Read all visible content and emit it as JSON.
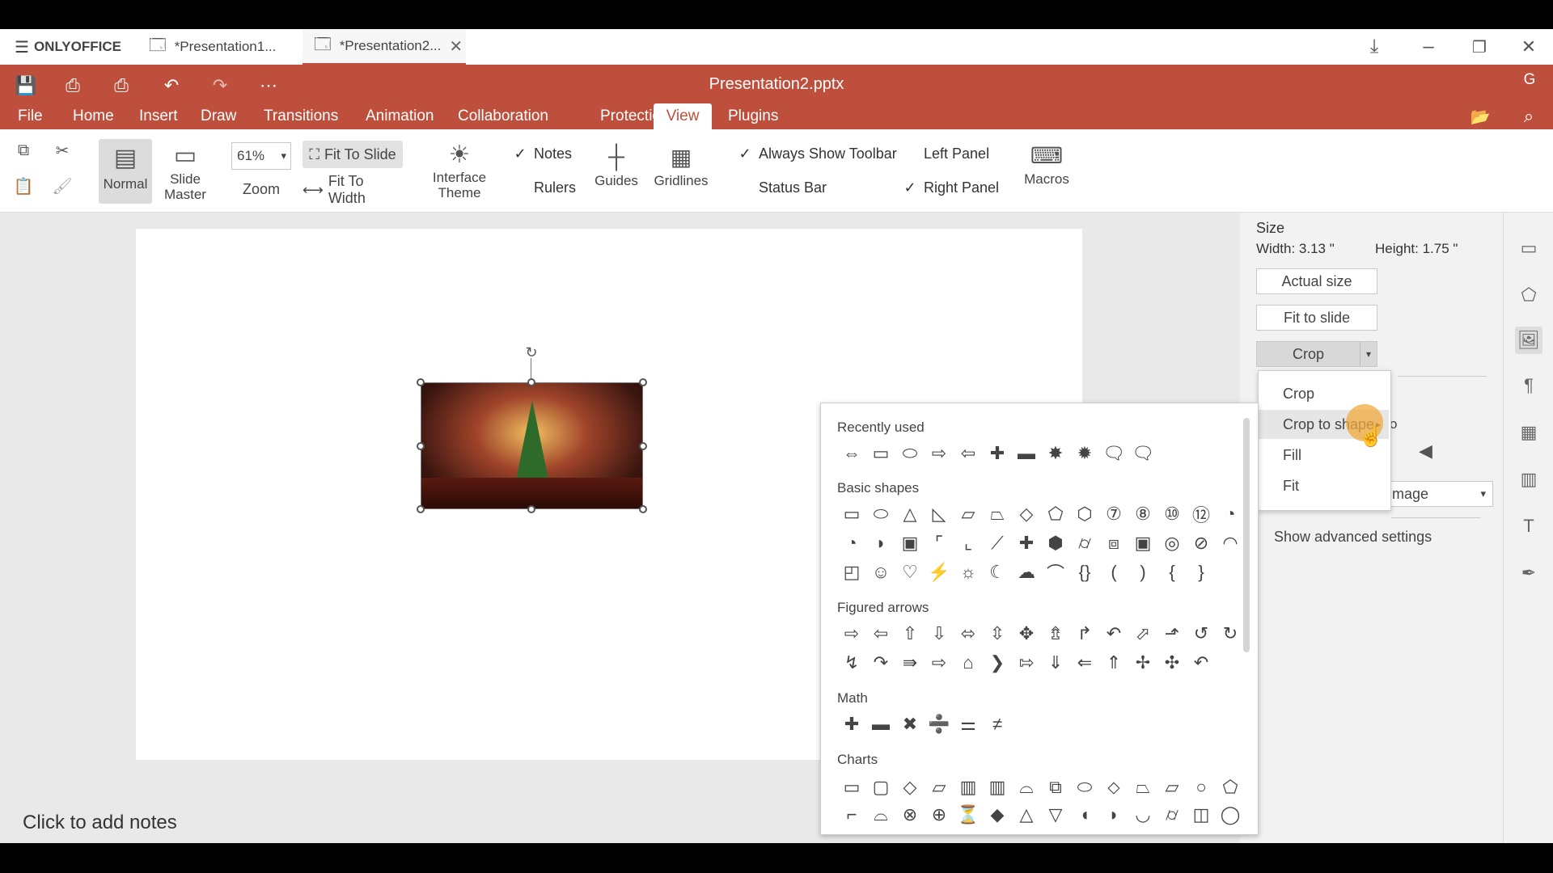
{
  "app": {
    "brand": "ONLYOFFICE",
    "file_title": "Presentation2.pptx",
    "avatar_letter": "G"
  },
  "doc_tabs": [
    {
      "label": "*Presentation1..."
    },
    {
      "label": "*Presentation2..."
    }
  ],
  "menu": [
    "File",
    "Home",
    "Insert",
    "Draw",
    "Transitions",
    "Animation",
    "Collaboration",
    "Protection",
    "View",
    "Plugins"
  ],
  "active_menu": "View",
  "ribbon": {
    "normal": "Normal",
    "slide_master": "Slide Master",
    "zoom_value": "61%",
    "zoom_label": "Zoom",
    "fit_to_slide": "Fit To Slide",
    "fit_to_width": "Fit To Width",
    "interface_theme": "Interface Theme",
    "notes": "Notes",
    "rulers": "Rulers",
    "guides": "Guides",
    "gridlines": "Gridlines",
    "always_show_toolbar": "Always Show Toolbar",
    "status_bar": "Status Bar",
    "left_panel": "Left Panel",
    "right_panel": "Right Panel",
    "macros": "Macros"
  },
  "checks": {
    "notes": true,
    "rulers": false,
    "always_show_toolbar": true,
    "status_bar": false,
    "left_panel": false,
    "right_panel": true
  },
  "right_panel": {
    "size_heading": "Size",
    "width": "Width: 3.13 \"",
    "height": "Height: 1.75 \"",
    "actual_size": "Actual size",
    "fit_to_slide": "Fit to slide",
    "crop": "Crop",
    "partial_text_1": "o",
    "image_button_partial": "mage",
    "advanced": "Show advanced settings"
  },
  "crop_menu": [
    "Crop",
    "Crop to shape",
    "Fill",
    "Fit"
  ],
  "shapes_panel": {
    "recently_used": "Recently used",
    "basic_shapes": "Basic shapes",
    "figured_arrows": "Figured arrows",
    "math": "Math",
    "charts": "Charts",
    "recent_icons": [
      "⇔",
      "▭",
      "⬭",
      "⇨",
      "⇦",
      "✚",
      "▬",
      "✸",
      "✹",
      "🗨",
      "🗨"
    ],
    "basic_row1": [
      "▭",
      "⬭",
      "△",
      "◺",
      "▱",
      "⏢",
      "◇",
      "⬠",
      "⬡",
      "⑦",
      "⑧",
      "⑩",
      "⑫",
      "◔"
    ],
    "basic_row2": [
      "◔",
      "◗",
      "▣",
      "⌜",
      "⌞",
      "⟋",
      "✚",
      "⬢",
      "⌭",
      "⧈",
      "▣",
      "◎",
      "⊘",
      "◠"
    ],
    "basic_row3": [
      "◰",
      "☺",
      "♡",
      "⚡",
      "☼",
      "☾",
      "☁",
      "⌒",
      "{}",
      "(",
      ")",
      "{",
      "}"
    ],
    "arrows_row1": [
      "⇨",
      "⇦",
      "⇧",
      "⇩",
      "⬄",
      "⇳",
      "✥",
      "⇯",
      "↱",
      "↶",
      "⬀",
      "⬏",
      "↺",
      "↻"
    ],
    "arrows_row2": [
      "↯",
      "↷",
      "⇛",
      "⇨",
      "⌂",
      "❯",
      "⇰",
      "⇓",
      "⇐",
      "⇑",
      "✢",
      "✣",
      "↶"
    ],
    "math_row": [
      "✚",
      "▬",
      "✖",
      "➗",
      "⚌",
      "≠"
    ],
    "charts_row1": [
      "▭",
      "▢",
      "◇",
      "▱",
      "▥",
      "▥",
      "⌓",
      "⧉",
      "⬭",
      "⬦",
      "⏢",
      "⏥",
      "○",
      "⬠"
    ],
    "charts_row2": [
      "⌐",
      "⌓",
      "⊗",
      "⊕",
      "⏳",
      "◆",
      "△",
      "▽",
      "◖",
      "◗",
      "◡",
      "⌭",
      "◫",
      "◯"
    ]
  },
  "notes_placeholder": "Click to add notes",
  "colors": {
    "accent": "#bf4f3d",
    "ribbon_bg": "#ffffff",
    "workspace_bg": "#e9e9e9"
  }
}
